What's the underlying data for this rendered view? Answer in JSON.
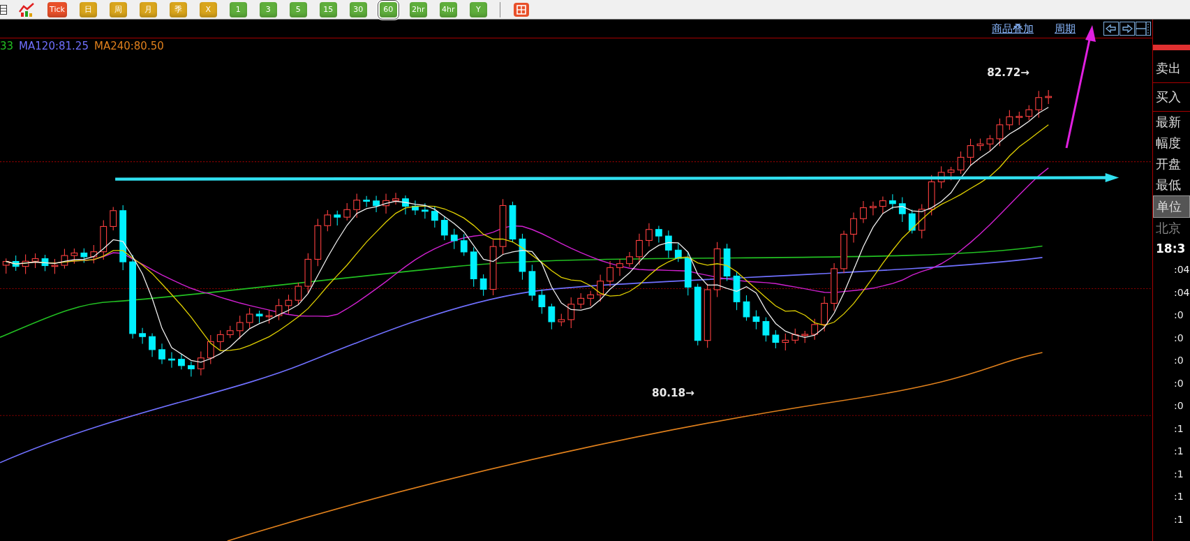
{
  "toolbar": {
    "buttons": [
      {
        "label": "Tick",
        "color": "#e8502a",
        "selected": false
      },
      {
        "label": "日",
        "color": "#d9a51c",
        "selected": false
      },
      {
        "label": "周",
        "color": "#d9a51c",
        "selected": false
      },
      {
        "label": "月",
        "color": "#d9a51c",
        "selected": false
      },
      {
        "label": "季",
        "color": "#d9a51c",
        "selected": false
      },
      {
        "label": "X",
        "color": "#d9a51c",
        "selected": false
      },
      {
        "label": "1",
        "color": "#5fae3c",
        "selected": false
      },
      {
        "label": "3",
        "color": "#5fae3c",
        "selected": false
      },
      {
        "label": "5",
        "color": "#5fae3c",
        "selected": false
      },
      {
        "label": "15",
        "color": "#5fae3c",
        "selected": false
      },
      {
        "label": "30",
        "color": "#5fae3c",
        "selected": false
      },
      {
        "label": "60",
        "color": "#5fae3c",
        "selected": true
      },
      {
        "label": "2hr",
        "color": "#5fae3c",
        "selected": false
      },
      {
        "label": "4hr",
        "color": "#5fae3c",
        "selected": false
      },
      {
        "label": "Y",
        "color": "#5fae3c",
        "selected": false
      }
    ]
  },
  "header": {
    "links": [
      "商品叠加",
      "周期"
    ]
  },
  "legend": [
    {
      "text": "33",
      "color": "#22c022"
    },
    {
      "text": "MA120:81.25",
      "color": "#7070ff"
    },
    {
      "text": "MA240:80.50",
      "color": "#e0801c"
    }
  ],
  "chart": {
    "high_label": "82.72→",
    "low_label": "80.18→"
  },
  "side_panel": {
    "rows": [
      {
        "label": "卖出",
        "selected": false,
        "disabled": false
      },
      {
        "label": "买入",
        "selected": false,
        "disabled": false
      },
      {
        "label": "最新",
        "selected": false,
        "disabled": false
      },
      {
        "label": "幅度",
        "selected": false,
        "disabled": false
      },
      {
        "label": "开盘",
        "selected": false,
        "disabled": false
      },
      {
        "label": "最低",
        "selected": false,
        "disabled": false
      },
      {
        "label": "单位",
        "selected": true,
        "disabled": false
      },
      {
        "label": "北京",
        "selected": false,
        "disabled": true
      }
    ],
    "time": "18:3",
    "ticks": [
      ":04",
      ":04",
      ":0",
      ":0",
      ":0",
      ":0",
      ":0",
      ":1",
      ":1",
      ":1",
      ":1",
      ":1"
    ]
  }
}
